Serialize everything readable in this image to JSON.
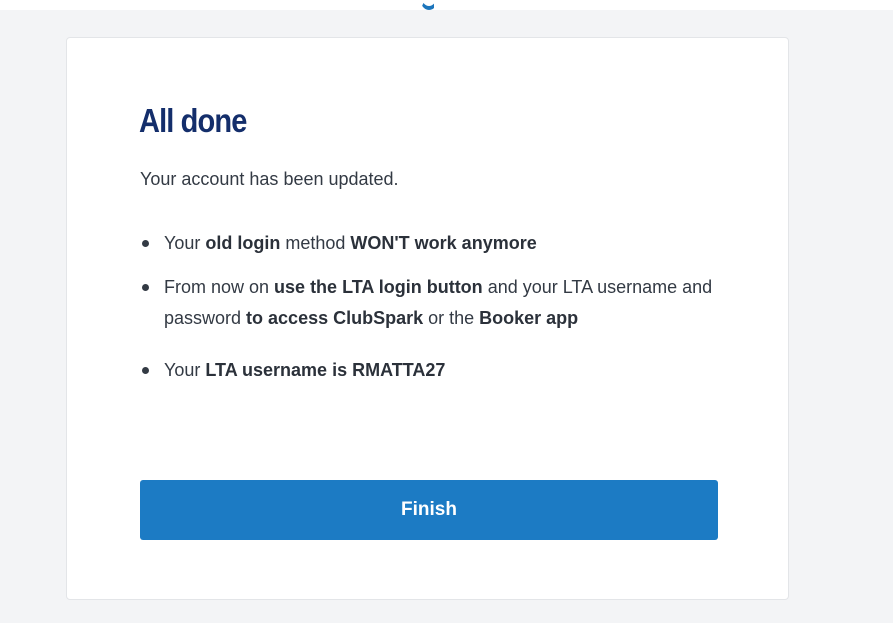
{
  "card": {
    "title": "All done",
    "intro": "Your account has been updated.",
    "bullets": [
      [
        {
          "text": "Your ",
          "bold": false
        },
        {
          "text": "old login",
          "bold": true
        },
        {
          "text": " method ",
          "bold": false
        },
        {
          "text": "WON'T work anymore",
          "bold": true
        }
      ],
      [
        {
          "text": "From now on ",
          "bold": false
        },
        {
          "text": "use the LTA login button",
          "bold": true
        },
        {
          "text": " and your LTA username and password ",
          "bold": false
        },
        {
          "text": "to access ClubSpark",
          "bold": true
        },
        {
          "text": " or the ",
          "bold": false
        },
        {
          "text": "Booker app",
          "bold": true
        }
      ],
      [
        {
          "text": "Your ",
          "bold": false
        },
        {
          "text": "LTA username is RMATTA27",
          "bold": true
        }
      ]
    ],
    "finish_label": "Finish"
  },
  "colors": {
    "title": "#142e6b",
    "button": "#1c7bc4",
    "page_background": "#f3f4f6"
  }
}
